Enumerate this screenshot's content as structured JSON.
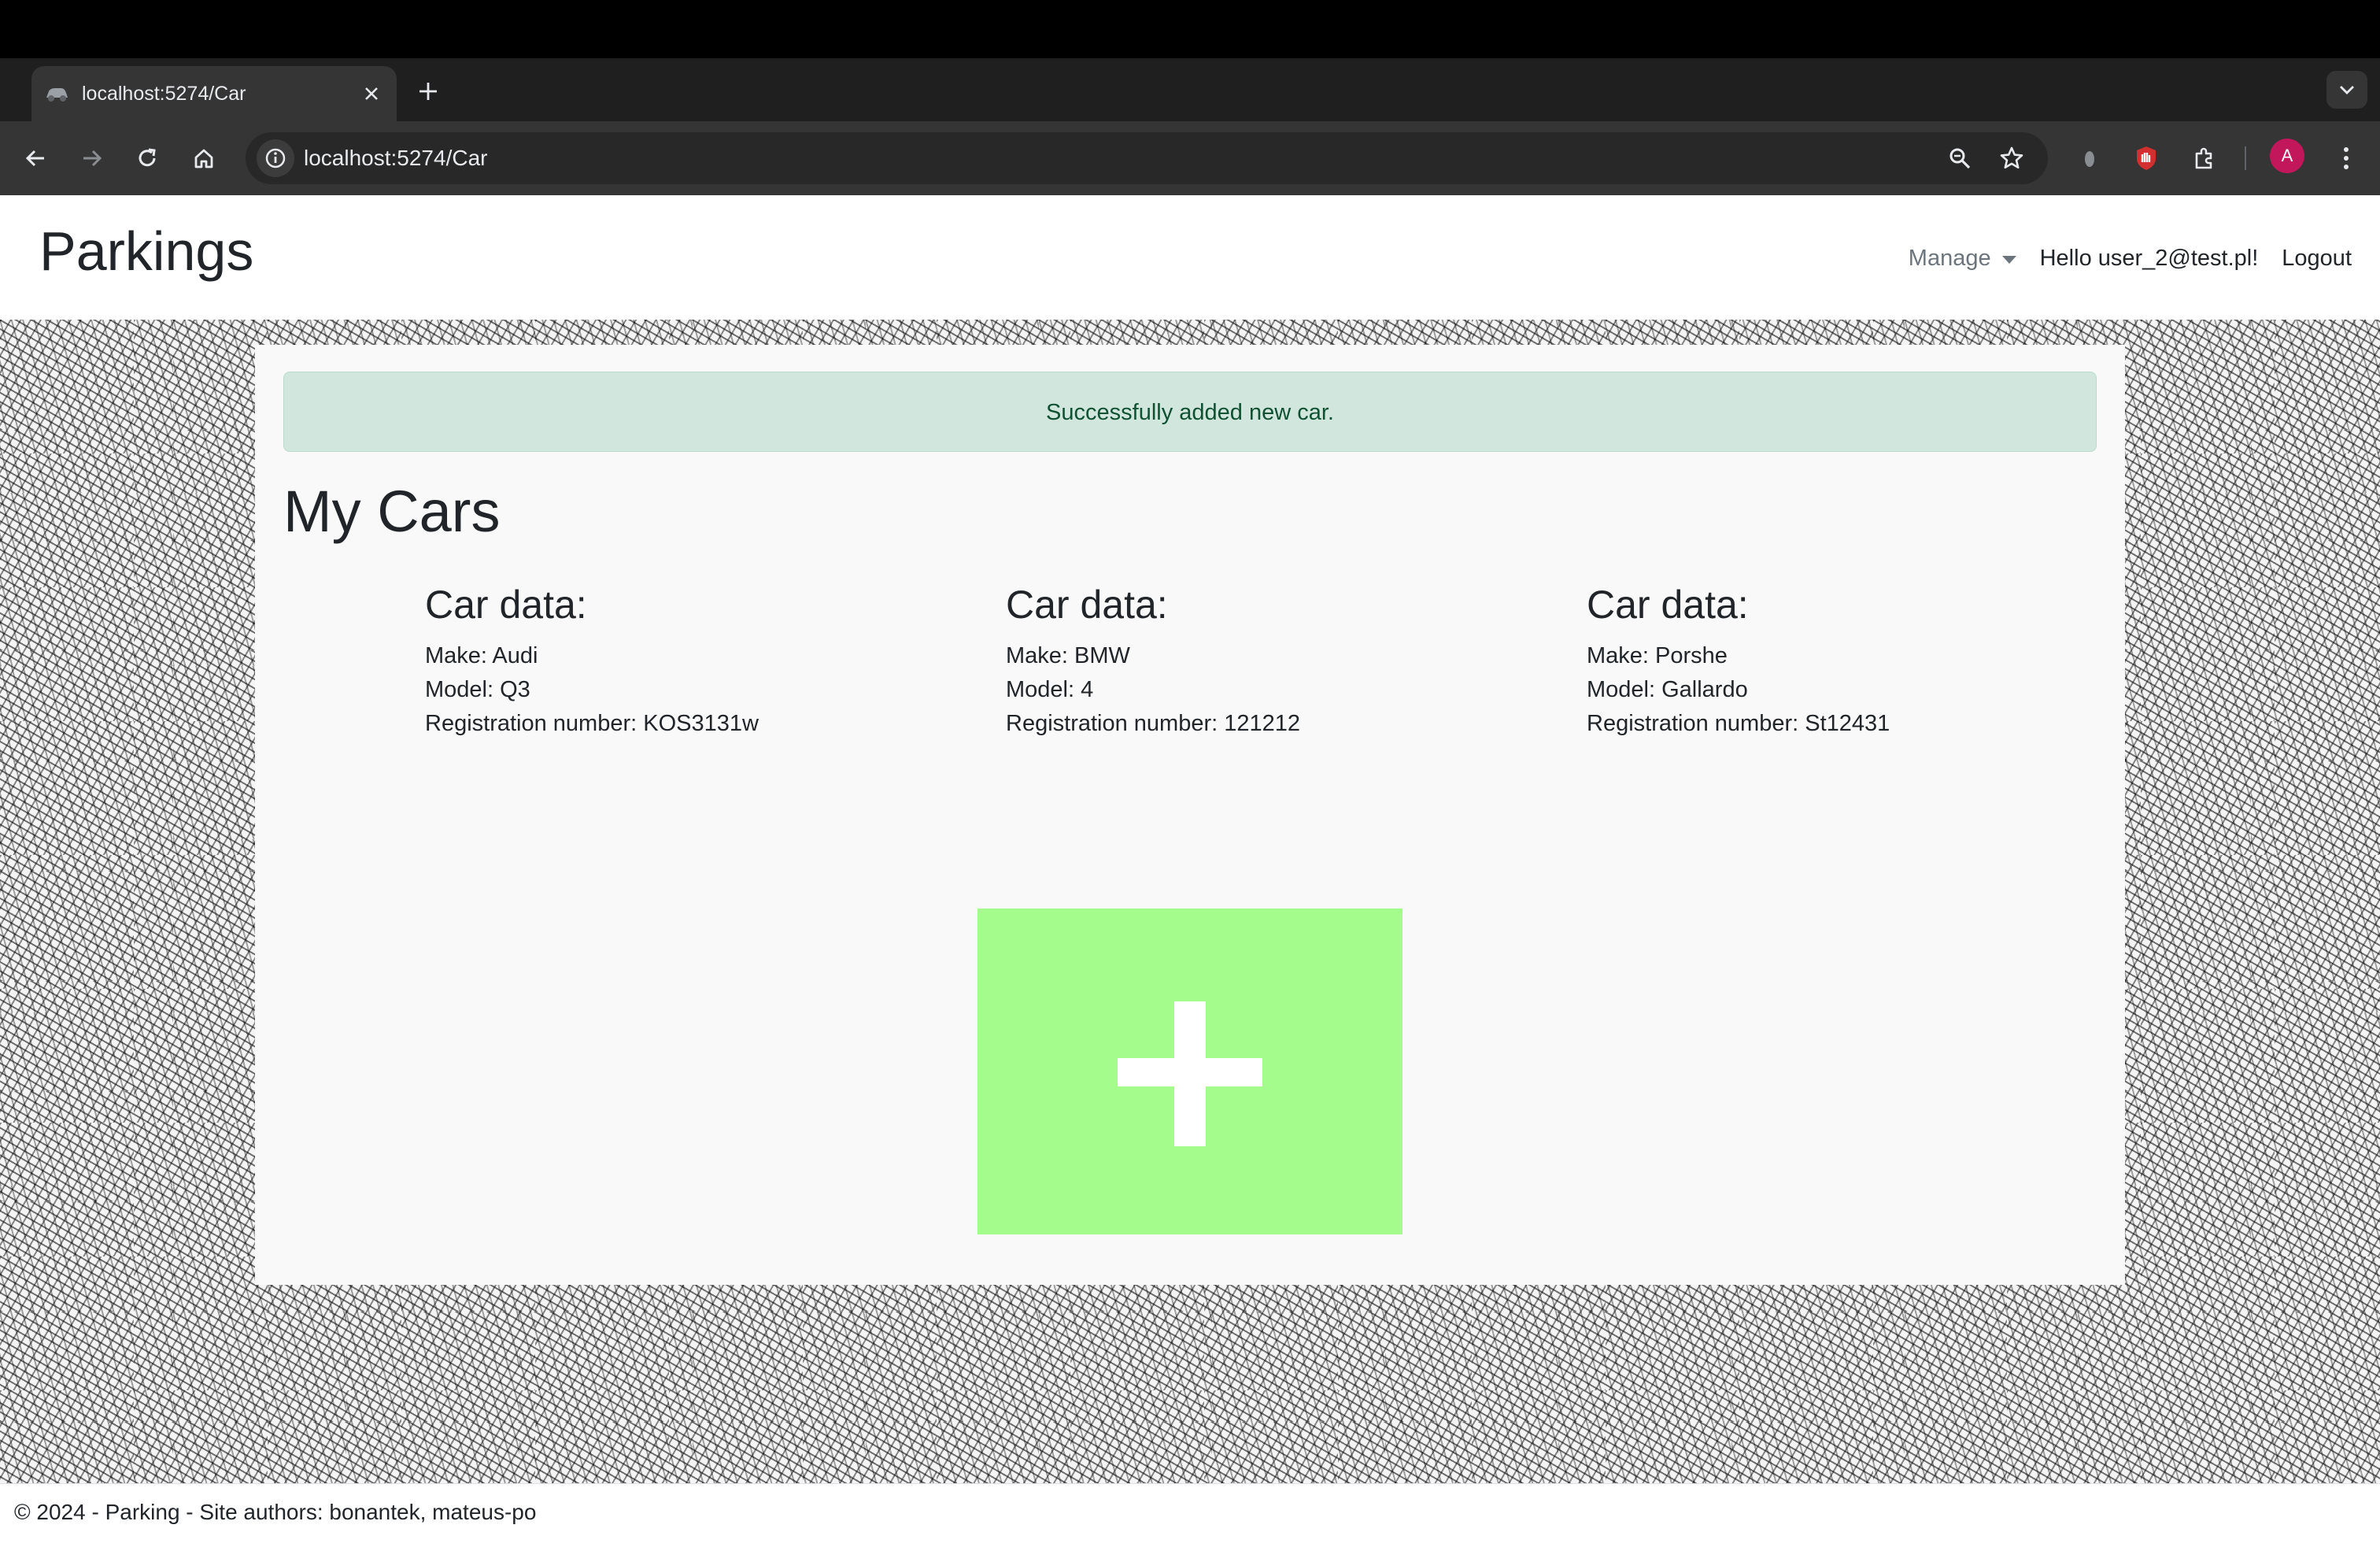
{
  "browser": {
    "tab_title": "localhost:5274/Car",
    "url": "localhost:5274/Car",
    "avatar_initial": "A"
  },
  "site": {
    "brand": "Parkings",
    "nav": {
      "manage": "Manage",
      "greeting": "Hello user_2@test.pl!",
      "logout": "Logout"
    }
  },
  "alert": {
    "message": "Successfully added new car."
  },
  "page": {
    "title": "My Cars"
  },
  "cars": [
    {
      "heading": "Car data:",
      "make": "Make: Audi",
      "model": "Model: Q3",
      "registration": "Registration number: KOS3131w"
    },
    {
      "heading": "Car data:",
      "make": "Make: BMW",
      "model": "Model: 4",
      "registration": "Registration number: 121212"
    },
    {
      "heading": "Car data:",
      "make": "Make: Porshe",
      "model": "Model: Gallardo",
      "registration": "Registration number: St12431"
    }
  ],
  "footer": {
    "text": "© 2024 - Parking - Site authors: bonantek, mateus-po"
  },
  "colors": {
    "add_button": "#a3fc8c",
    "alert_bg": "#d1e7dd",
    "alert_text": "#0f5132",
    "avatar": "#c2185b"
  }
}
